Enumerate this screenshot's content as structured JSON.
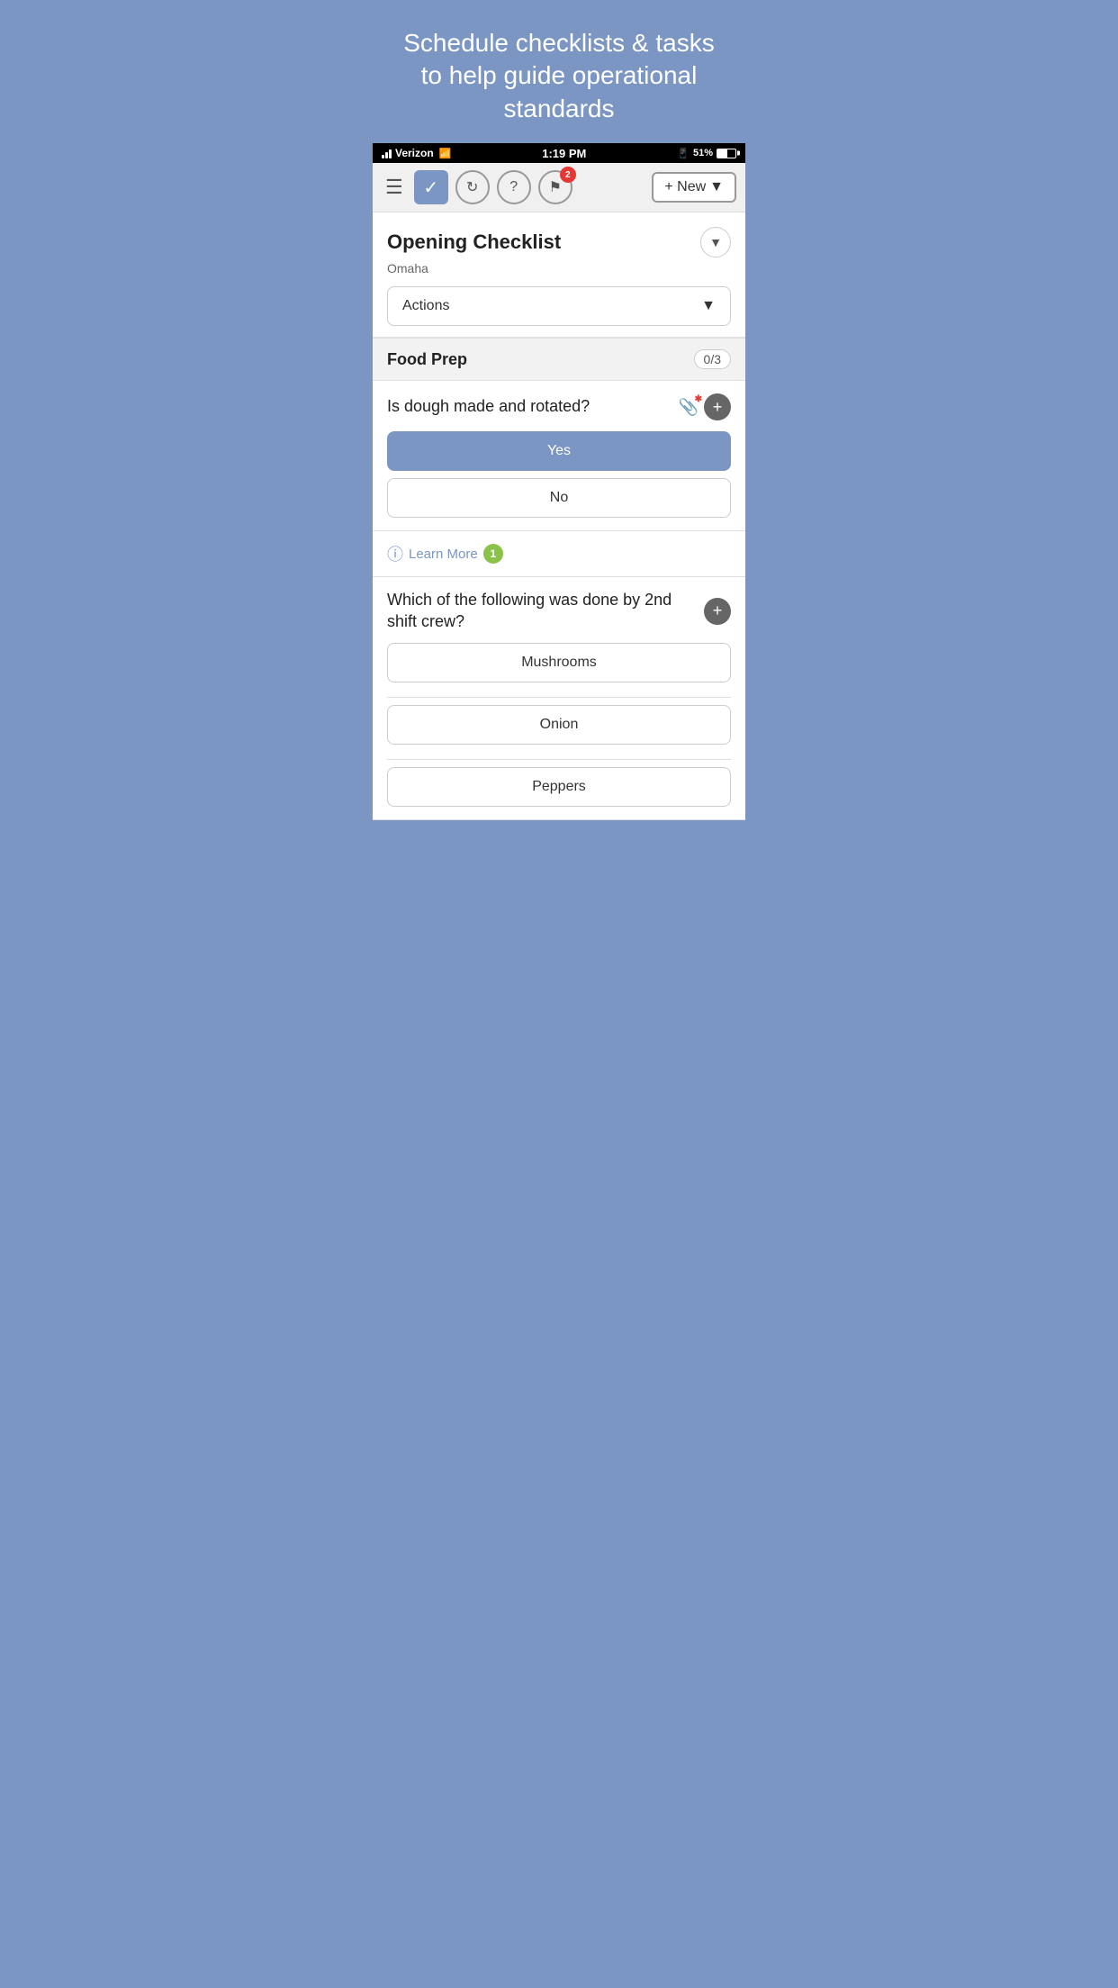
{
  "hero": {
    "title": "Schedule checklists & tasks to help guide operational standards"
  },
  "status_bar": {
    "carrier": "Verizon",
    "time": "1:19 PM",
    "battery": "51%"
  },
  "toolbar": {
    "new_label": "+ New",
    "flag_badge": "2"
  },
  "checklist": {
    "title": "Opening Checklist",
    "subtitle": "Omaha",
    "actions_label": "Actions",
    "sections": [
      {
        "name": "Food Prep",
        "count": "0/3",
        "questions": [
          {
            "text": "Is dough made and rotated?",
            "has_attachment": true,
            "answers": [
              {
                "label": "Yes",
                "selected": true
              },
              {
                "label": "No",
                "selected": false
              }
            ],
            "learn_more": {
              "label": "Learn More",
              "count": "1"
            }
          },
          {
            "text": "Which of the following was done by 2nd shift crew?",
            "has_attachment": false,
            "answers": [
              {
                "label": "Mushrooms",
                "selected": false
              },
              {
                "label": "Onion",
                "selected": false
              },
              {
                "label": "Peppers",
                "selected": false
              }
            ]
          }
        ]
      }
    ]
  }
}
